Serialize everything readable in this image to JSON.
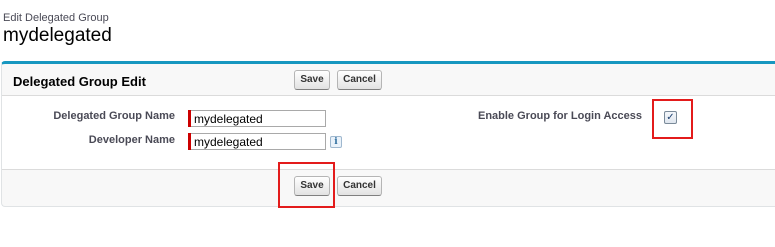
{
  "header": {
    "subtitle": "Edit Delegated Group",
    "title": "mydelegated"
  },
  "section": {
    "title": "Delegated Group Edit"
  },
  "buttons": {
    "save": "Save",
    "cancel": "Cancel"
  },
  "fields": {
    "group_name_label": "Delegated Group Name",
    "group_name_value": "mydelegated",
    "developer_name_label": "Developer Name",
    "developer_name_value": "mydelegated",
    "login_access_label": "Enable Group for Login Access",
    "login_access_checked": true,
    "info_icon_glyph": "i",
    "check_glyph": "✓"
  },
  "colors": {
    "accent": "#1797c0",
    "required": "#cc0000",
    "highlight": "#e31b1b"
  }
}
